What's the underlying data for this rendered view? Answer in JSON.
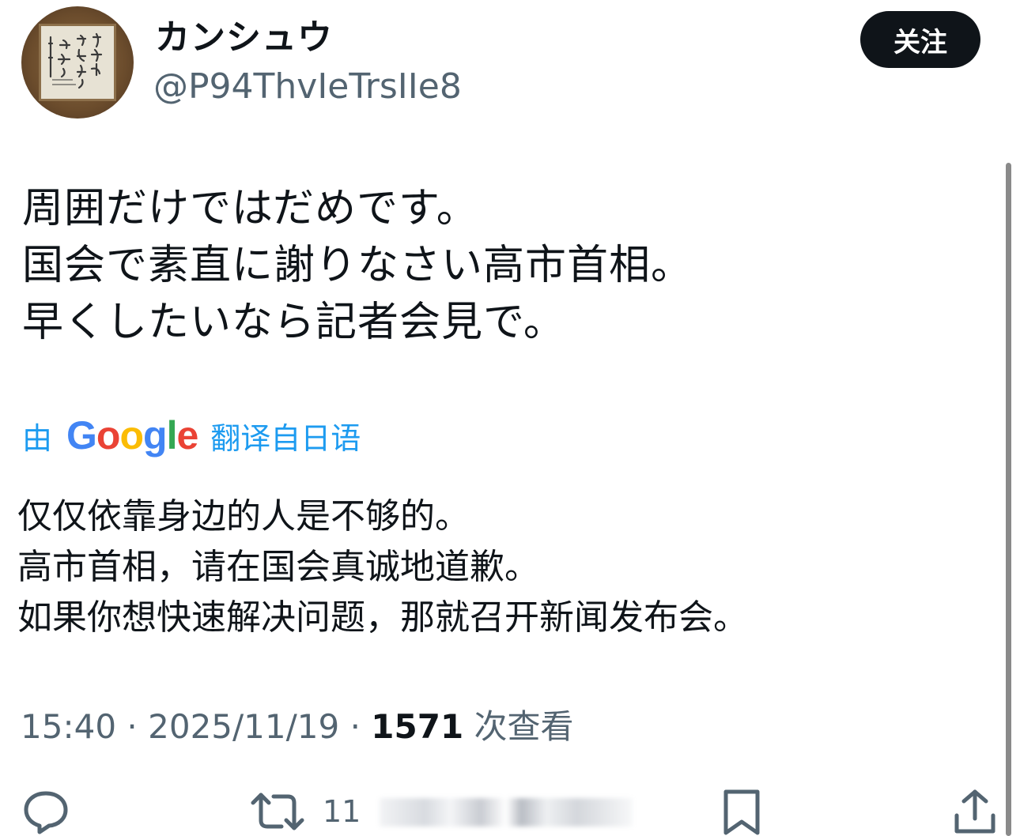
{
  "user": {
    "display_name": "カンシュウ",
    "handle": "@P94ThvIeTrsIIe8",
    "avatar": "calligraphy-frame-avatar"
  },
  "follow_button": {
    "label": "关注"
  },
  "tweet": {
    "text": "周囲だけではだめです。\n国会で素直に謝りなさい高市首相。\n早くしたいなら記者会見で。"
  },
  "translation": {
    "prefix": "由",
    "provider": "Google",
    "suffix": "翻译自日语",
    "text": "仅仅依靠身边的人是不够的。\n高市首相，请在国会真诚地道歉。\n如果你想快速解决问题，那就召开新闻发布会。"
  },
  "meta": {
    "time": "15:40",
    "separator": "·",
    "date": "2025/11/19",
    "views_count": "1571",
    "views_label": "次查看"
  },
  "actions": {
    "reply_icon": "reply-icon",
    "retweet_icon": "retweet-icon",
    "retweet_count": "11",
    "bookmark_icon": "bookmark-icon",
    "share_icon": "share-icon"
  },
  "colors": {
    "link_blue": "#1d9bf0",
    "muted_gray": "#536471",
    "text_black": "#0f1419",
    "button_black": "#0f1419"
  }
}
